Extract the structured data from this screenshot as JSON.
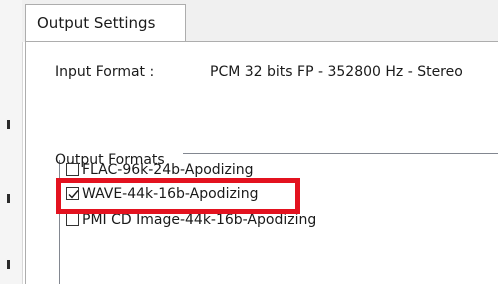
{
  "tabs": [
    {
      "label": "Output Settings",
      "selected": true
    }
  ],
  "input_format": {
    "label": "Input Format :",
    "value": "PCM 32 bits FP - 352800 Hz - Stereo"
  },
  "output_formats": {
    "label": "Output Formats",
    "items": [
      {
        "label": "FLAC-96k-24b-Apodizing",
        "checked": false
      },
      {
        "label": "WAVE-44k-16b-Apodizing",
        "checked": true,
        "highlighted": true
      },
      {
        "label": "PMI CD Image-44k-16b-Apodizing",
        "checked": false
      }
    ]
  },
  "colors": {
    "highlight": "#e3121f",
    "tab_strip": "#f0f0f0",
    "panel": "#ffffff",
    "border": "#adadad"
  },
  "icons": {
    "checked": "check-icon"
  }
}
